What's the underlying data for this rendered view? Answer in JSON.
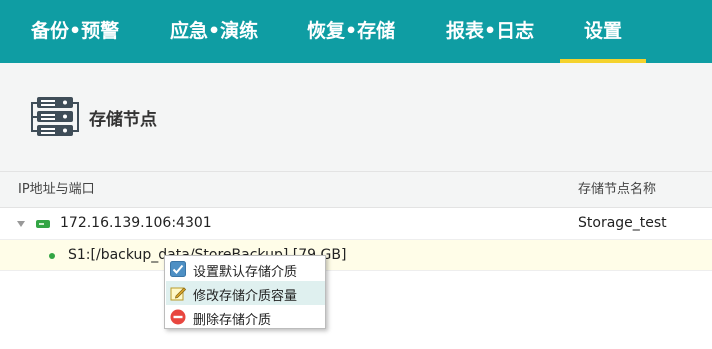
{
  "nav": {
    "items": [
      {
        "label": "备份•预警"
      },
      {
        "label": "应急•演练"
      },
      {
        "label": "恢复•存储"
      },
      {
        "label": "报表•日志"
      },
      {
        "label": "设置"
      }
    ],
    "active_index": 4
  },
  "page": {
    "title": "存储节点",
    "icon": "server-rack-icon"
  },
  "table": {
    "columns": [
      "IP地址与端口",
      "存储节点名称"
    ],
    "rows": [
      {
        "address": "172.16.139.106:4301",
        "name": "Storage_test",
        "expanded": true,
        "icon": "storage-node-icon"
      },
      {
        "address": "S1:[/backup_data/StoreBackup] [79 GB]",
        "name": "",
        "icon": "status-dot-icon"
      }
    ]
  },
  "context_menu": {
    "items": [
      {
        "label": "设置默认存储介质",
        "icon": "checkbox-checked-icon"
      },
      {
        "label": "修改存储介质容量",
        "icon": "edit-icon"
      },
      {
        "label": "删除存储介质",
        "icon": "delete-minus-icon"
      }
    ],
    "highlighted_index": 1
  },
  "colors": {
    "nav_bg": "#0f9da3",
    "nav_active_underline": "#f4d22c",
    "node_green": "#33a544",
    "selected_row_bg": "#fffde8",
    "menu_highlight": "#dff0ef",
    "delete_red": "#e8463f"
  }
}
